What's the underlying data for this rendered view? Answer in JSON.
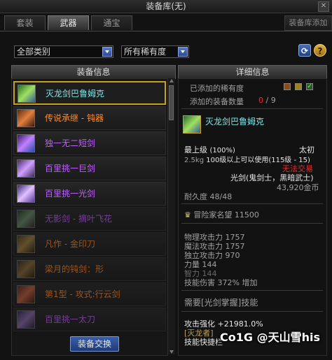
{
  "window": {
    "title": "装备库(无)"
  },
  "tabs": [
    {
      "label": "套装"
    },
    {
      "label": "武器"
    },
    {
      "label": "通宝"
    }
  ],
  "right_tab": {
    "label": "装备库添加"
  },
  "filters": {
    "category": "全部类别",
    "rarity": "所有稀有度"
  },
  "left_panel": {
    "header": "装备信息",
    "items": [
      {
        "name": "灭龙剑巴鲁姆克",
        "color": "#7fe6e6"
      },
      {
        "name": "传说承继 - 钝器",
        "color": "#ff8a2a"
      },
      {
        "name": "独一无二短剑",
        "color": "#c060ff"
      },
      {
        "name": "百里挑一巨剑",
        "color": "#c060ff"
      },
      {
        "name": "百里挑一光剑",
        "color": "#c060ff"
      },
      {
        "name": "无影剑 - 摘叶飞花",
        "color": "#c060ff"
      },
      {
        "name": "凡作 - 金印刀",
        "color": "#ff8a2a"
      },
      {
        "name": "梁月的钝剑：形",
        "color": "#ff8a2a"
      },
      {
        "name": "第1型 - 攻式:行云剑",
        "color": "#ff8a2a"
      },
      {
        "name": "百里挑一太刀",
        "color": "#c060ff"
      }
    ],
    "exchange_button": "装备交换"
  },
  "right_panel": {
    "header": "详细信息",
    "added_rarity_label": "已添加的稀有度",
    "added_count_label": "添加的装备数量",
    "added_count": "0",
    "added_total": "/ 9",
    "item_name": "灭龙剑巴鲁姆克",
    "grade_label": "最上级",
    "grade_pct": "(100%)",
    "grade_right": "太初",
    "weight": "2.5kg",
    "level_req": "100级以上可以使用(115级 - 15)",
    "trade": "无法交易",
    "weapon_type": "光剑(鬼剑士，黑暗武士)",
    "price": "43,920金币",
    "durability": "耐久度 48/48",
    "fame_label": "冒险家名望",
    "fame_value": "11500",
    "stats": [
      "物理攻击力 1757",
      "魔法攻击力 1757",
      "独立攻击力 970",
      "力量 144",
      "智力 144",
      "技能伤害 372% 增加"
    ],
    "req_skill": "需要[光剑掌握]技能",
    "attack_boost": "攻击强化 +21981.0%",
    "set_name": "[灭龙者]",
    "skill_hotkey": "技能快捷栏"
  },
  "watermark": "Co1G @天山雪his"
}
